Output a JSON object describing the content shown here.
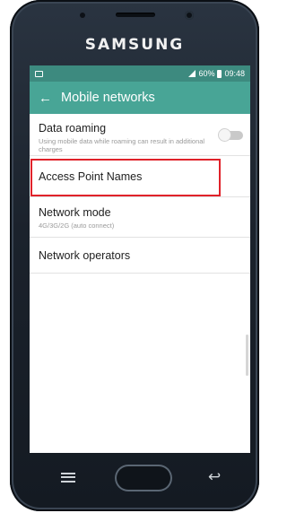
{
  "device": {
    "brand": "SAMSUNG"
  },
  "statusbar": {
    "battery": "60%",
    "time": "09:48",
    "notification_icon": "image-icon",
    "signal_icon": "signal-icon",
    "battery_icon": "battery-icon"
  },
  "appbar": {
    "back_icon": "←",
    "title": "Mobile networks"
  },
  "settings": [
    {
      "title": "Data roaming",
      "subtitle": "Using mobile data while roaming can result in additional charges",
      "toggle": false
    },
    {
      "title": "Access Point Names",
      "highlighted": true
    },
    {
      "title": "Network mode",
      "subtitle": "4G/3G/2G (auto connect)"
    },
    {
      "title": "Network operators"
    }
  ],
  "hardware_keys": {
    "back": "↩"
  },
  "colors": {
    "statusbar": "#3d8a7f",
    "appbar": "#48a596",
    "highlight": "#e0222a"
  }
}
